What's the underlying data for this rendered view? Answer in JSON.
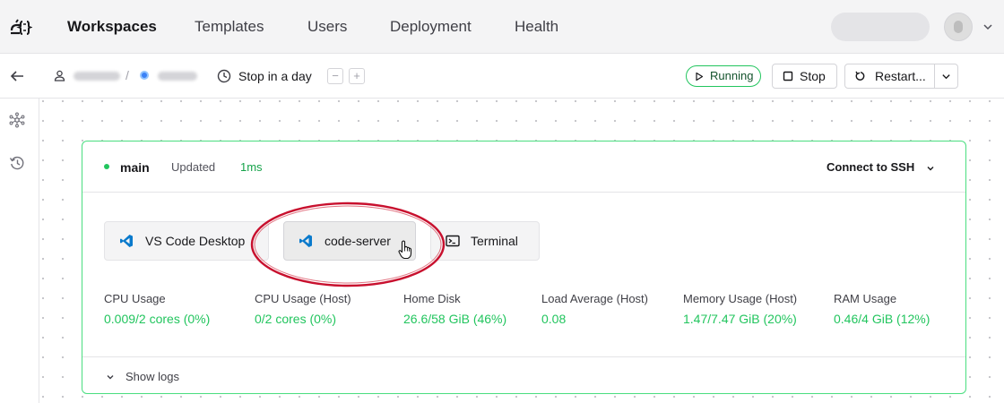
{
  "nav": {
    "items": [
      "Workspaces",
      "Templates",
      "Users",
      "Deployment",
      "Health"
    ],
    "active": "Workspaces"
  },
  "workspace_bar": {
    "stop_text": "Stop in a day",
    "decrease_label": "−",
    "increase_label": "+",
    "status": "Running",
    "stop_label": "Stop",
    "restart_label": "Restart..."
  },
  "agent": {
    "name": "main",
    "updated_label": "Updated",
    "updated_value": "1ms",
    "connect_label": "Connect to SSH",
    "apps": [
      "VS Code Desktop",
      "code-server",
      "Terminal"
    ],
    "metrics": [
      {
        "label": "CPU Usage",
        "value": "0.009/2 cores (0%)"
      },
      {
        "label": "CPU Usage (Host)",
        "value": "0/2 cores (0%)"
      },
      {
        "label": "Home Disk",
        "value": "26.6/58 GiB (46%)"
      },
      {
        "label": "Load Average (Host)",
        "value": "0.08"
      },
      {
        "label": "Memory Usage (Host)",
        "value": "1.47/7.47 GiB (20%)"
      },
      {
        "label": "RAM Usage",
        "value": "0.46/4 GiB (12%)"
      }
    ],
    "show_logs_label": "Show logs"
  },
  "colors": {
    "accent_green": "#22c55e",
    "vscode_blue": "#0a7acc",
    "highlight_red": "#c8102e"
  },
  "icons": [
    "coder-logo-icon",
    "chevron-down-icon",
    "back-arrow-icon",
    "user-icon",
    "clock-icon",
    "play-icon",
    "stop-icon",
    "restart-icon",
    "nodes-icon",
    "history-icon",
    "vscode-icon",
    "terminal-icon",
    "pointer-cursor-icon"
  ]
}
